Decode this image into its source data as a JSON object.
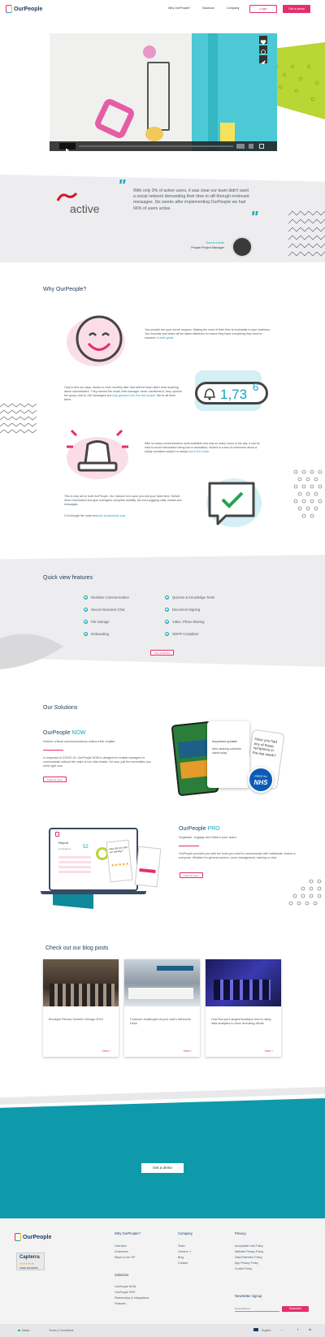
{
  "header": {
    "logo_text": "OurPeople",
    "nav": [
      "Why OurPeople?",
      "Solutions",
      "Company"
    ],
    "login_label": "Login",
    "demo_label": "Get a demo"
  },
  "testimonial": {
    "quote": "With only 3% of active users, it was clear our team didn't want a social network demanding their time to sift through irrelevant messages. Six weeks after implementing OurPeople we had 66% of users active.",
    "brand": "active",
    "name": "Emma Leeds",
    "role": "People Project Manager"
  },
  "why": {
    "title": "Why OurPeople?",
    "p1": "Your people are your secret weapon. Making the most of their time is invaluable to your business. You innovate and share all the latest initiatives to ensure they have everything they need to succeed.",
    "p1_link": "It feels great.",
    "p2": "Only to find our days, weeks or even monthly later that half the team didn't hear anything about said initiative. They missed the email, their manager never mentioned it, they opened the group chat to 100 messages and",
    "p2_link": "only glanced over the last couple.",
    "p2_end": "We've all been there.",
    "counter": "1,73",
    "counter_sup": "6",
    "p3": "With so many communication tools available and only so many hours in the day, it can be hard to avoid information being lost in translation, diluted in a sea of comments about a totally unrelated subject or simply",
    "p3_link": "lost in the noise.",
    "p4": "This is why we've built OurPeople. Our mission is to save you and your team time. Deliver direct information and give managers complete visibility. No more juggling calls, emails and messages.",
    "p5": "Cut through the noise and",
    "p5_link": "see productivity soar."
  },
  "features": {
    "title": "Quick view features",
    "left": [
      "Realtime Communication",
      "Secure Business Chat",
      "File Storage",
      "Onboarding"
    ],
    "right": [
      "Quizzes & Knowledge Tests",
      "Document Signing",
      "Video, Photo Sharing",
      "GDPR Compliant"
    ],
    "button_label": "View Features"
  },
  "solutions": {
    "title": "Our Solutions",
    "now": {
      "name": "OurPeople",
      "suffix": "NOW",
      "subtitle": "Deliver critical communications without the chatter",
      "text": "In response to COVID-19, OurPeople NOW is designed to enable managers to communicate without the noise of non vital chatter. No fuss, just the necessities you need right now.",
      "button": "Find out more",
      "phone_title": "Important update!",
      "phone_text": "New cleaning schedule starts today.",
      "phone_right": "Have you had any of these symptoms in the last week?",
      "badge_top": "FREE for",
      "badge_bottom": "NHS"
    },
    "pro": {
      "name": "OurPeople",
      "suffix": "PRO",
      "subtitle": "Organise, engage and inform your team",
      "text": "OurPeople provides you with the tools you need to communicate with individuals, teams or everyone. Whether it's general comms, cover management, training or chat.",
      "button": "Find out more",
      "report_title": "Report",
      "report_label": "Completed",
      "report_value": "52",
      "quiz_text": "How did you rate our training?"
    }
  },
  "blog": {
    "title": "Check out our blog posts",
    "posts": [
      {
        "title": "Boutique Fitness Summit Chicago 2019",
        "view": "View"
      },
      {
        "title": "Common challenges at your club's Welcome Desk",
        "view": "View"
      },
      {
        "title": "How Europe's largest boutique club is using data analytics to drive recruiting efforts",
        "view": "View"
      }
    ]
  },
  "cta": {
    "label": "Get a demo"
  },
  "footer": {
    "logo_text": "OurPeople",
    "badge_top": "Capterra",
    "badge_bottom": "USER REVIEWS",
    "col1_title": "Why OurPeople?",
    "col1": [
      "Overview",
      "Customers",
      "Ways to use OP"
    ],
    "col1b_title": "Solutions",
    "col1b": [
      "OurPeople NOW",
      "OurPeople PRO",
      "Partnerships & Integrations",
      "Features"
    ],
    "col2_title": "Company",
    "col2": [
      "Team",
      "Careers",
      "Blog",
      "Contact"
    ],
    "col3_title": "Privacy",
    "col3": [
      "Acceptable Use Policy",
      "Website Privacy Policy",
      "Data Retention Policy",
      "App Privacy Policy",
      "Cookie Policy"
    ],
    "newsletter_title": "Newsletter signup",
    "email_placeholder": "Email address",
    "subscribe": "Subscribe",
    "status": "Status",
    "terms": "Terms & Conditions",
    "language": "English"
  },
  "colors": {
    "brand_pink": "#e52e6b",
    "brand_teal": "#17a6bd",
    "navy": "#1f3c5a",
    "cta_bg": "#0e9aab"
  }
}
